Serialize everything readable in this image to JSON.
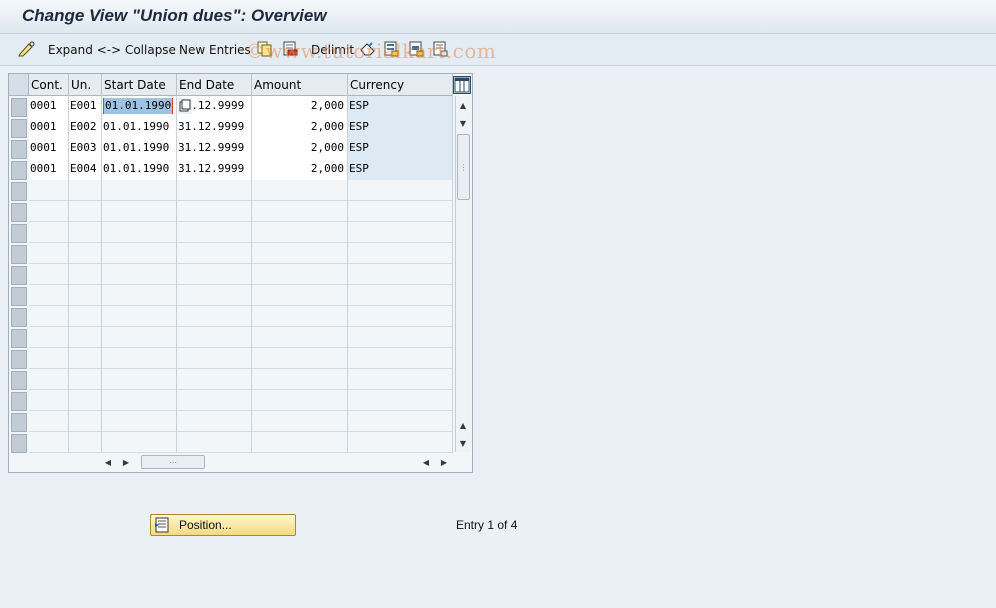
{
  "window": {
    "title": "Change View \"Union dues\": Overview"
  },
  "toolbar": {
    "expand_collapse_label": "Expand <-> Collapse",
    "new_entries_label": "New Entries",
    "delimit_label": "Delimit"
  },
  "watermark": "©www.tutorialkart.com",
  "table": {
    "columns": [
      "Cont.",
      "Un.",
      "Start Date",
      "End Date",
      "Amount",
      "Currency"
    ],
    "rows": [
      [
        "0001",
        "E001",
        "01.01.1990",
        "31.12.9999",
        "2,000",
        "ESP"
      ],
      [
        "0001",
        "E002",
        "01.01.1990",
        "31.12.9999",
        "2,000",
        "ESP"
      ],
      [
        "0001",
        "E003",
        "01.01.1990",
        "31.12.9999",
        "2,000",
        "ESP"
      ],
      [
        "0001",
        "E004",
        "01.01.1990",
        "31.12.9999",
        "2,000",
        "ESP"
      ]
    ],
    "empty_rows": 13
  },
  "position_button": {
    "label": "Position..."
  },
  "status": {
    "entry_text": "Entry 1 of 4"
  },
  "colors": {
    "accent": "#1a2a3c",
    "button_yellow": "#f3d980",
    "selected_cell": "#9ec3e3"
  }
}
